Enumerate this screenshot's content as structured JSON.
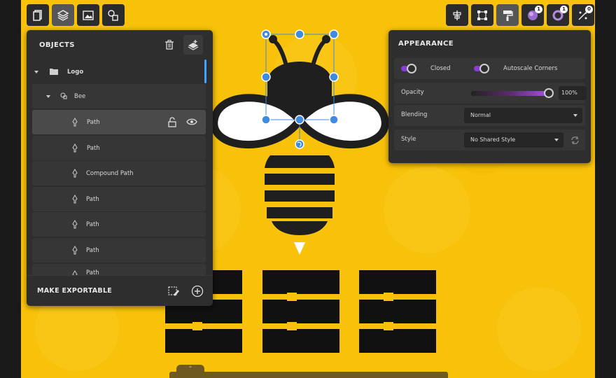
{
  "objects_panel": {
    "title": "OBJECTS",
    "footer_label": "MAKE EXPORTABLE",
    "layers": [
      {
        "name": "Logo",
        "type": "group"
      },
      {
        "name": "Bee",
        "type": "symbol"
      },
      {
        "name": "Path",
        "type": "path",
        "selected": true
      },
      {
        "name": "Path",
        "type": "path"
      },
      {
        "name": "Compound Path",
        "type": "path"
      },
      {
        "name": "Path",
        "type": "path"
      },
      {
        "name": "Path",
        "type": "path"
      },
      {
        "name": "Path",
        "type": "path"
      },
      {
        "name": "Path",
        "type": "path"
      }
    ]
  },
  "appearance_panel": {
    "title": "APPEARANCE",
    "closed_label": "Closed",
    "autoscale_label": "Autoscale Corners",
    "opacity_label": "Opacity",
    "opacity_value": "100%",
    "blending_label": "Blending",
    "blending_value": "Normal",
    "style_label": "Style",
    "style_value": "No Shared Style"
  },
  "toolbar": {
    "fill_badge": "1",
    "stroke_badge": "1",
    "effects_badge": "0"
  },
  "colors": {
    "canvas": "#f8c20a",
    "accent": "#3fa3ff",
    "toggle": "#8a3dd6",
    "panel": "#2e2e2e"
  }
}
